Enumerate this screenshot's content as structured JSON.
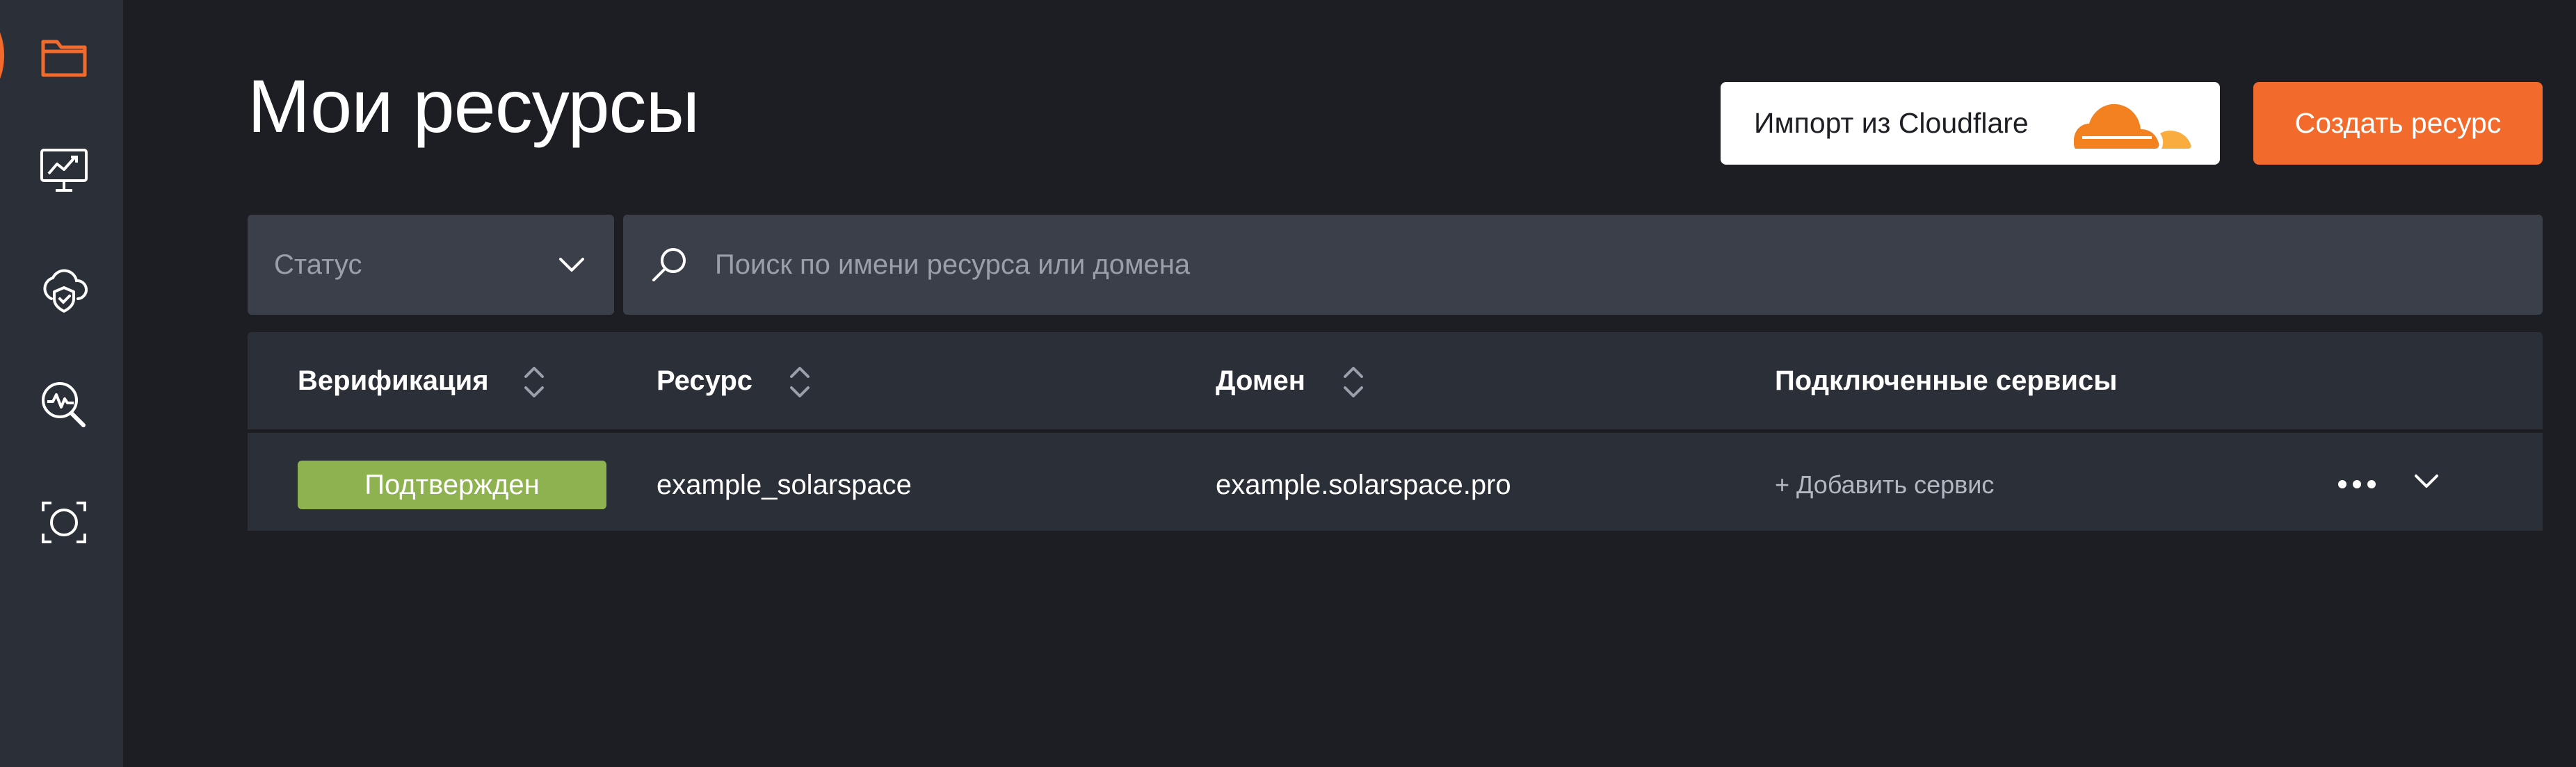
{
  "sidebar": {
    "items": [
      {
        "icon": "folder-icon",
        "active": true
      },
      {
        "icon": "monitor-chart-icon",
        "active": false
      },
      {
        "icon": "cloud-shield-icon",
        "active": false
      },
      {
        "icon": "search-analytics-icon",
        "active": false
      },
      {
        "icon": "scan-focus-icon",
        "active": false
      }
    ],
    "accent_color": "#f26b2d"
  },
  "header": {
    "title": "Мои ресурсы",
    "import_button": {
      "label": "Импорт из Cloudflare",
      "icon": "cloudflare-logo"
    },
    "create_button": {
      "label": "Создать ресурс",
      "color": "#f26b2d"
    }
  },
  "filters": {
    "status": {
      "selected": "Статус"
    },
    "search": {
      "placeholder": "Поиск по имени ресурса или домена",
      "value": ""
    }
  },
  "table": {
    "columns": [
      {
        "label": "Верификация",
        "sortable": true
      },
      {
        "label": "Ресурс",
        "sortable": true
      },
      {
        "label": "Домен",
        "sortable": true
      },
      {
        "label": "Подключенные сервисы",
        "sortable": false
      }
    ],
    "rows": [
      {
        "status": "Подтвержден",
        "status_color": "#8fb251",
        "resource": "example_solarspace",
        "domain": "example.solarspace.pro",
        "services_action": "+ Добавить сервис"
      }
    ]
  }
}
